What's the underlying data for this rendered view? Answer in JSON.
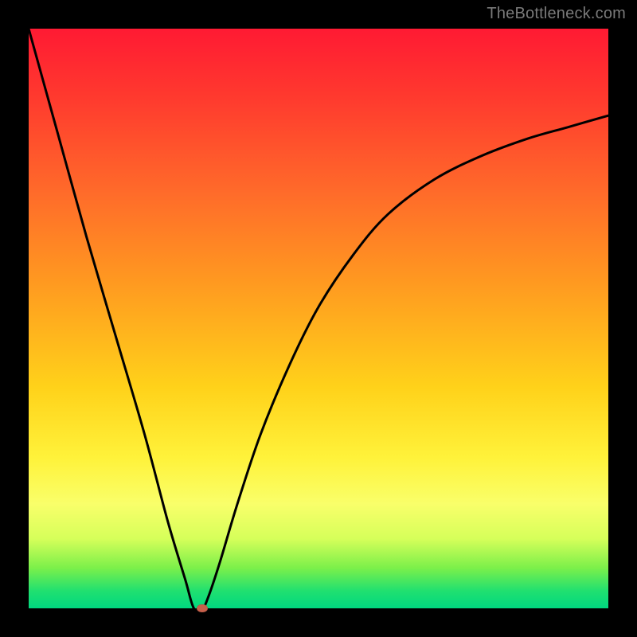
{
  "watermark": "TheBottleneck.com",
  "chart_data": {
    "type": "line",
    "title": "",
    "xlabel": "",
    "ylabel": "",
    "xlim": [
      0,
      1
    ],
    "ylim": [
      0,
      1
    ],
    "grid": false,
    "legend": null,
    "background": "rainbow-vertical",
    "series": [
      {
        "name": "curve",
        "color": "#000000",
        "x": [
          0.0,
          0.05,
          0.1,
          0.15,
          0.2,
          0.24,
          0.27,
          0.285,
          0.3,
          0.31,
          0.33,
          0.36,
          0.4,
          0.45,
          0.5,
          0.56,
          0.62,
          0.7,
          0.78,
          0.86,
          0.93,
          1.0
        ],
        "values": [
          1.0,
          0.82,
          0.64,
          0.47,
          0.3,
          0.15,
          0.05,
          0.0,
          0.0,
          0.02,
          0.08,
          0.18,
          0.3,
          0.42,
          0.52,
          0.61,
          0.68,
          0.74,
          0.78,
          0.81,
          0.83,
          0.85
        ]
      }
    ],
    "marker": {
      "x": 0.3,
      "y": 0.0,
      "color": "#c7604b"
    }
  }
}
